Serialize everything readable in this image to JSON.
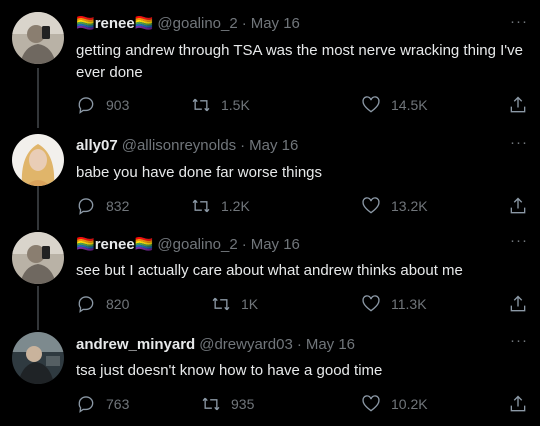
{
  "tweets": [
    {
      "name": "renee",
      "name_emoji_left": "🏳️‍🌈",
      "name_emoji_right": "🏳️‍🌈",
      "handle": "@goalino_2",
      "date": "May 16",
      "text": "getting andrew through TSA was the most nerve wracking thing I've ever done",
      "replies": "903",
      "retweets": "1.5K",
      "likes": "14.5K"
    },
    {
      "name": "ally07",
      "handle": "@allisonreynolds",
      "date": "May 16",
      "text": "babe you have done far worse things",
      "replies": "832",
      "retweets": "1.2K",
      "likes": "13.2K"
    },
    {
      "name": "renee",
      "name_emoji_left": "🏳️‍🌈",
      "name_emoji_right": "🏳️‍🌈",
      "handle": "@goalino_2",
      "date": "May 16",
      "text": "see but I actually care about what andrew thinks about me",
      "replies": "820",
      "retweets": "1K",
      "likes": "11.3K"
    },
    {
      "name": "andrew_minyard",
      "handle": "@drewyard03",
      "date": "May 16",
      "text": "tsa just doesn't know how to have a good time",
      "replies": "763",
      "retweets": "935",
      "likes": "10.2K"
    }
  ],
  "separator": "·",
  "more_label": "···",
  "colors": {
    "background": "#000000",
    "text": "#e7e9ea",
    "secondary": "#71767b",
    "thread_line": "#333639"
  }
}
